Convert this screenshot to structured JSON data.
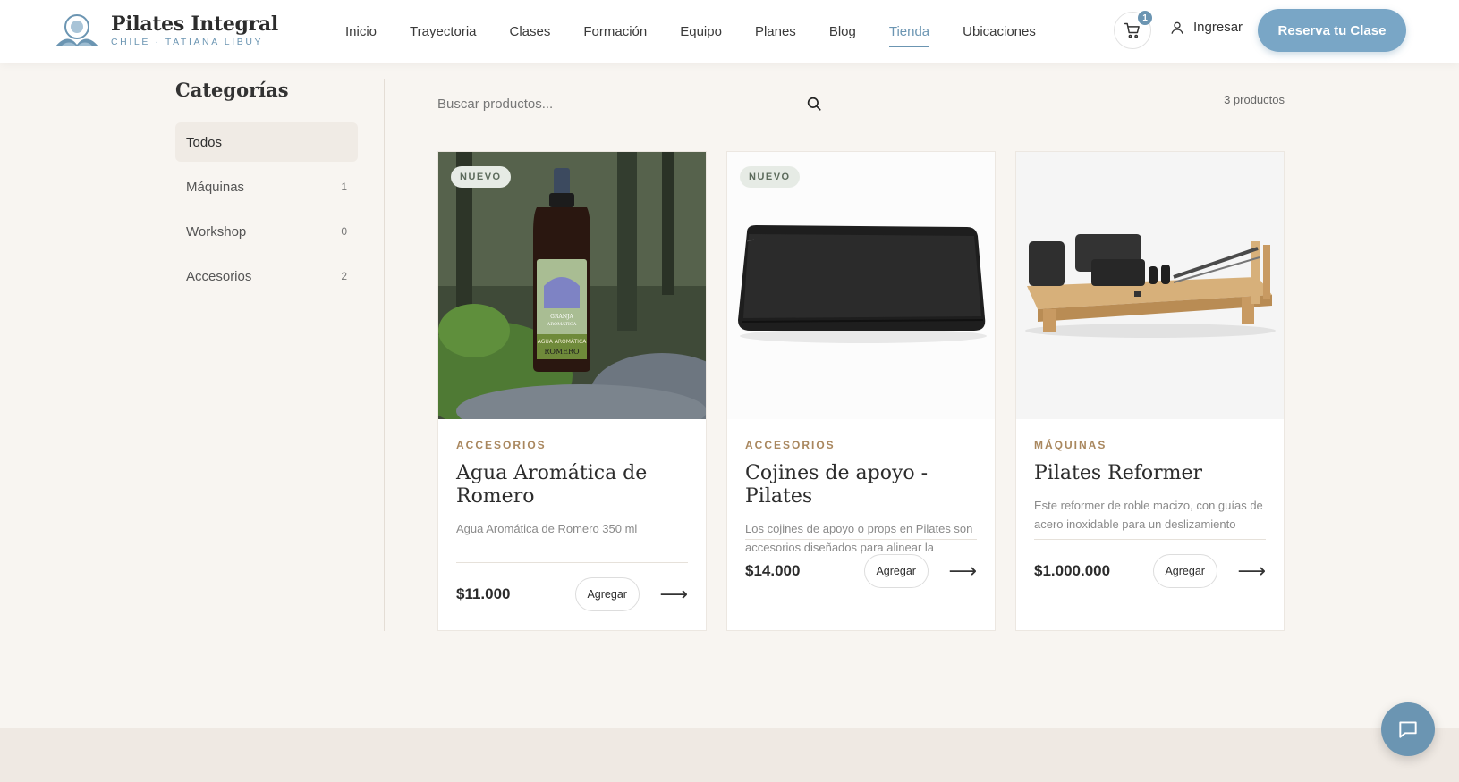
{
  "brand": {
    "title": "Pilates Integral",
    "subtitle": "CHILE · TATIANA LIBUY"
  },
  "nav": [
    {
      "label": "Inicio"
    },
    {
      "label": "Trayectoria"
    },
    {
      "label": "Clases"
    },
    {
      "label": "Formación"
    },
    {
      "label": "Equipo"
    },
    {
      "label": "Planes"
    },
    {
      "label": "Blog"
    },
    {
      "label": "Tienda",
      "active": true
    },
    {
      "label": "Ubicaciones"
    }
  ],
  "cart": {
    "count": "1"
  },
  "login_label": "Ingresar",
  "cta_label": "Reserva tu Clase",
  "sidebar": {
    "title": "Categorías",
    "items": [
      {
        "label": "Todos",
        "count": "",
        "active": true
      },
      {
        "label": "Máquinas",
        "count": "1"
      },
      {
        "label": "Workshop",
        "count": "0"
      },
      {
        "label": "Accesorios",
        "count": "2"
      }
    ]
  },
  "search": {
    "placeholder": "Buscar productos..."
  },
  "product_count": "3 productos",
  "products": [
    {
      "badge": "NUEVO",
      "category": "ACCESORIOS",
      "title": "Agua Aromática de Romero",
      "description": "Agua Aromática de Romero 350 ml",
      "price": "$11.000",
      "add_label": "Agregar",
      "label_lines": [
        "GRANJA",
        "AROMÁTICA",
        "AGUA AROMÁTICA",
        "ROMERO"
      ]
    },
    {
      "badge": "NUEVO",
      "category": "ACCESORIOS",
      "title": "Cojines de apoyo - Pilates",
      "description": "Los cojines de apoyo o props en Pilates son accesorios diseñados para alinear la columna.",
      "price": "$14.000",
      "add_label": "Agregar"
    },
    {
      "badge": "",
      "category": "MÁQUINAS",
      "title": "Pilates Reformer",
      "description": "Este reformer de roble macizo, con guías de acero inoxidable para un deslizamiento suave.",
      "price": "$1.000.000",
      "add_label": "Agregar"
    }
  ],
  "colors": {
    "accent": "#6b95b2",
    "cta": "#79a6c6",
    "category": "#a9875e",
    "page_bg": "#f8f5f1"
  }
}
